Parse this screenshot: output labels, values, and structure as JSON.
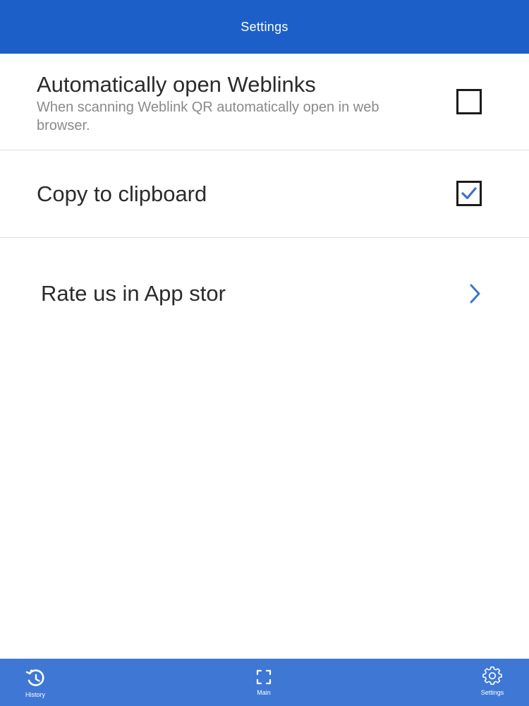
{
  "header": {
    "title": "Settings"
  },
  "settings": {
    "auto_open": {
      "title": "Automatically open Weblinks",
      "subtitle": "When scanning Weblink QR automatically open in web browser.",
      "checked": false
    },
    "clipboard": {
      "title": "Copy to clipboard",
      "checked": true
    },
    "rate": {
      "title": "Rate us in App stor",
      "icon": "chevron-right-icon"
    }
  },
  "tabbar": {
    "items": [
      {
        "label": "History",
        "icon": "history-icon"
      },
      {
        "label": "Main",
        "icon": "scan-frame-icon"
      },
      {
        "label": "Settings",
        "icon": "gear-icon"
      }
    ]
  },
  "colors": {
    "header": "#1c5fc8",
    "tabbar": "#3f78d4",
    "check": "#3f6fcf",
    "chevron": "#3a78c8"
  }
}
